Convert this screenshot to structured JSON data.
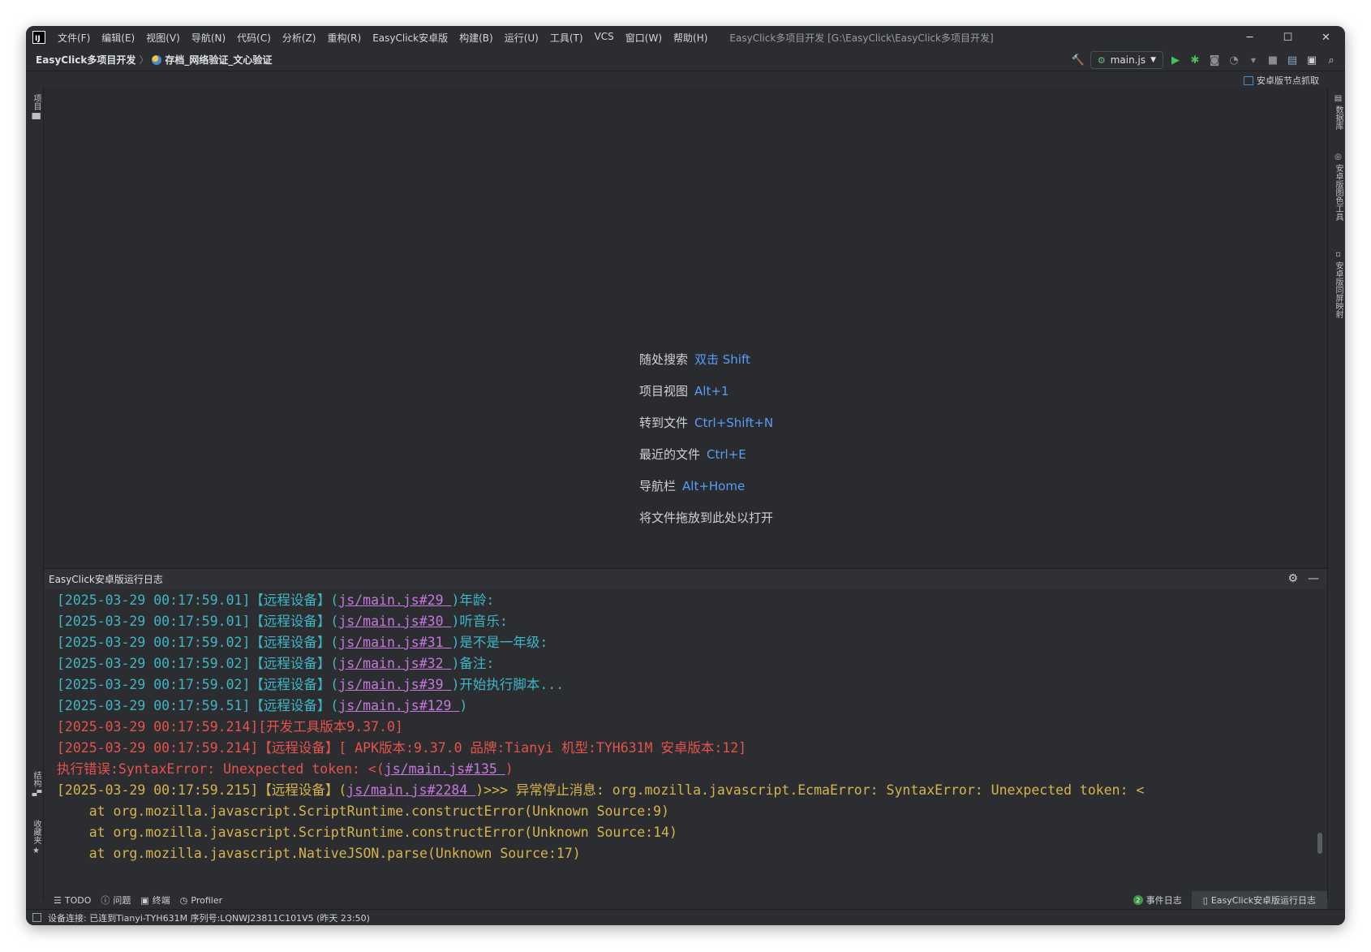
{
  "menu": [
    "文件(F)",
    "编辑(E)",
    "视图(V)",
    "导航(N)",
    "代码(C)",
    "分析(Z)",
    "重构(R)",
    "EasyClick安卓版",
    "构建(B)",
    "运行(U)",
    "工具(T)",
    "VCS",
    "窗口(W)",
    "帮助(H)"
  ],
  "window_title": "EasyClick多项目开发 [G:\\EasyClick\\EasyClick多项目开发]",
  "breadcrumb": {
    "project": "EasyClick多项目开发",
    "module": "存档_网络验证_文心验证"
  },
  "run_config": "main.js",
  "node_capture": "安卓版节点抓取",
  "left_tabs": {
    "project": "项目",
    "structure": "结构",
    "favorites": "收藏夹"
  },
  "right_tabs": {
    "database": "数据库",
    "image_tool": "安卓版图色工具",
    "mirror": "安卓版同屏映射"
  },
  "hints": [
    {
      "label": "随处搜索",
      "key": "双击 Shift"
    },
    {
      "label": "项目视图",
      "key": "Alt+1"
    },
    {
      "label": "转到文件",
      "key": "Ctrl+Shift+N"
    },
    {
      "label": "最近的文件",
      "key": "Ctrl+E"
    },
    {
      "label": "导航栏",
      "key": "Alt+Home"
    },
    {
      "label": "将文件拖放到此处以打开",
      "key": ""
    }
  ],
  "log_title": "EasyClick安卓版运行日志",
  "log": {
    "l1": {
      "ts": "[2025-03-29 00:17:59.01]",
      "dev": "【远程设备】(",
      "link": "js/main.js#29 ",
      "msg": ")年龄:"
    },
    "l2": {
      "ts": "[2025-03-29 00:17:59.01]",
      "dev": "【远程设备】(",
      "link": "js/main.js#30 ",
      "msg": ")听音乐:"
    },
    "l3": {
      "ts": "[2025-03-29 00:17:59.02]",
      "dev": "【远程设备】(",
      "link": "js/main.js#31 ",
      "msg": ")是不是一年级:"
    },
    "l4": {
      "ts": "[2025-03-29 00:17:59.02]",
      "dev": "【远程设备】(",
      "link": "js/main.js#32 ",
      "msg": ")备注:"
    },
    "l5": {
      "ts": "[2025-03-29 00:17:59.02]",
      "dev": "【远程设备】(",
      "link": "js/main.js#39 ",
      "msg": ")开始执行脚本..."
    },
    "l6": {
      "ts": "[2025-03-29 00:17:59.51]",
      "dev": "【远程设备】(",
      "link": "js/main.js#129 ",
      "msg": ")"
    },
    "l7": {
      "text": "[2025-03-29 00:17:59.214][开发工具版本9.37.0]"
    },
    "l8": {
      "text": "[2025-03-29 00:17:59.214]【远程设备】[ APK版本:9.37.0 品牌:Tianyi 机型:TYH631M 安卓版本:12]"
    },
    "l9": {
      "pre": "执行错误:SyntaxError: Unexpected token: <(",
      "link": "js/main.js#135 ",
      "post": ")"
    },
    "l10": {
      "ts": "[2025-03-29 00:17:59.215]【远程设备】(",
      "link": "js/main.js#2284 ",
      "msg": ")>>> 异常停止消息: org.mozilla.javascript.EcmaError: SyntaxError: Unexpected token: <"
    },
    "l11": "    at org.mozilla.javascript.ScriptRuntime.constructError(Unknown Source:9)",
    "l12": "    at org.mozilla.javascript.ScriptRuntime.constructError(Unknown Source:14)",
    "l13": "    at org.mozilla.javascript.NativeJSON.parse(Unknown Source:17)"
  },
  "tool_tabs": {
    "todo": "TODO",
    "problems": "问题",
    "terminal": "终端",
    "profiler": "Profiler"
  },
  "event_log": {
    "count": "2",
    "label": "事件日志"
  },
  "active_tool_tab": "EasyClick安卓版运行日志",
  "status": "设备连接: 已连到Tianyi-TYH631M 序列号:LQNWJ23811C101V5 (昨天 23:50)",
  "colors": {
    "accent_link": "#589df6",
    "log_cyan": "#3fb6c6",
    "log_link": "#c678dd",
    "log_red": "#e5534b",
    "log_yellow": "#d7b44b"
  }
}
